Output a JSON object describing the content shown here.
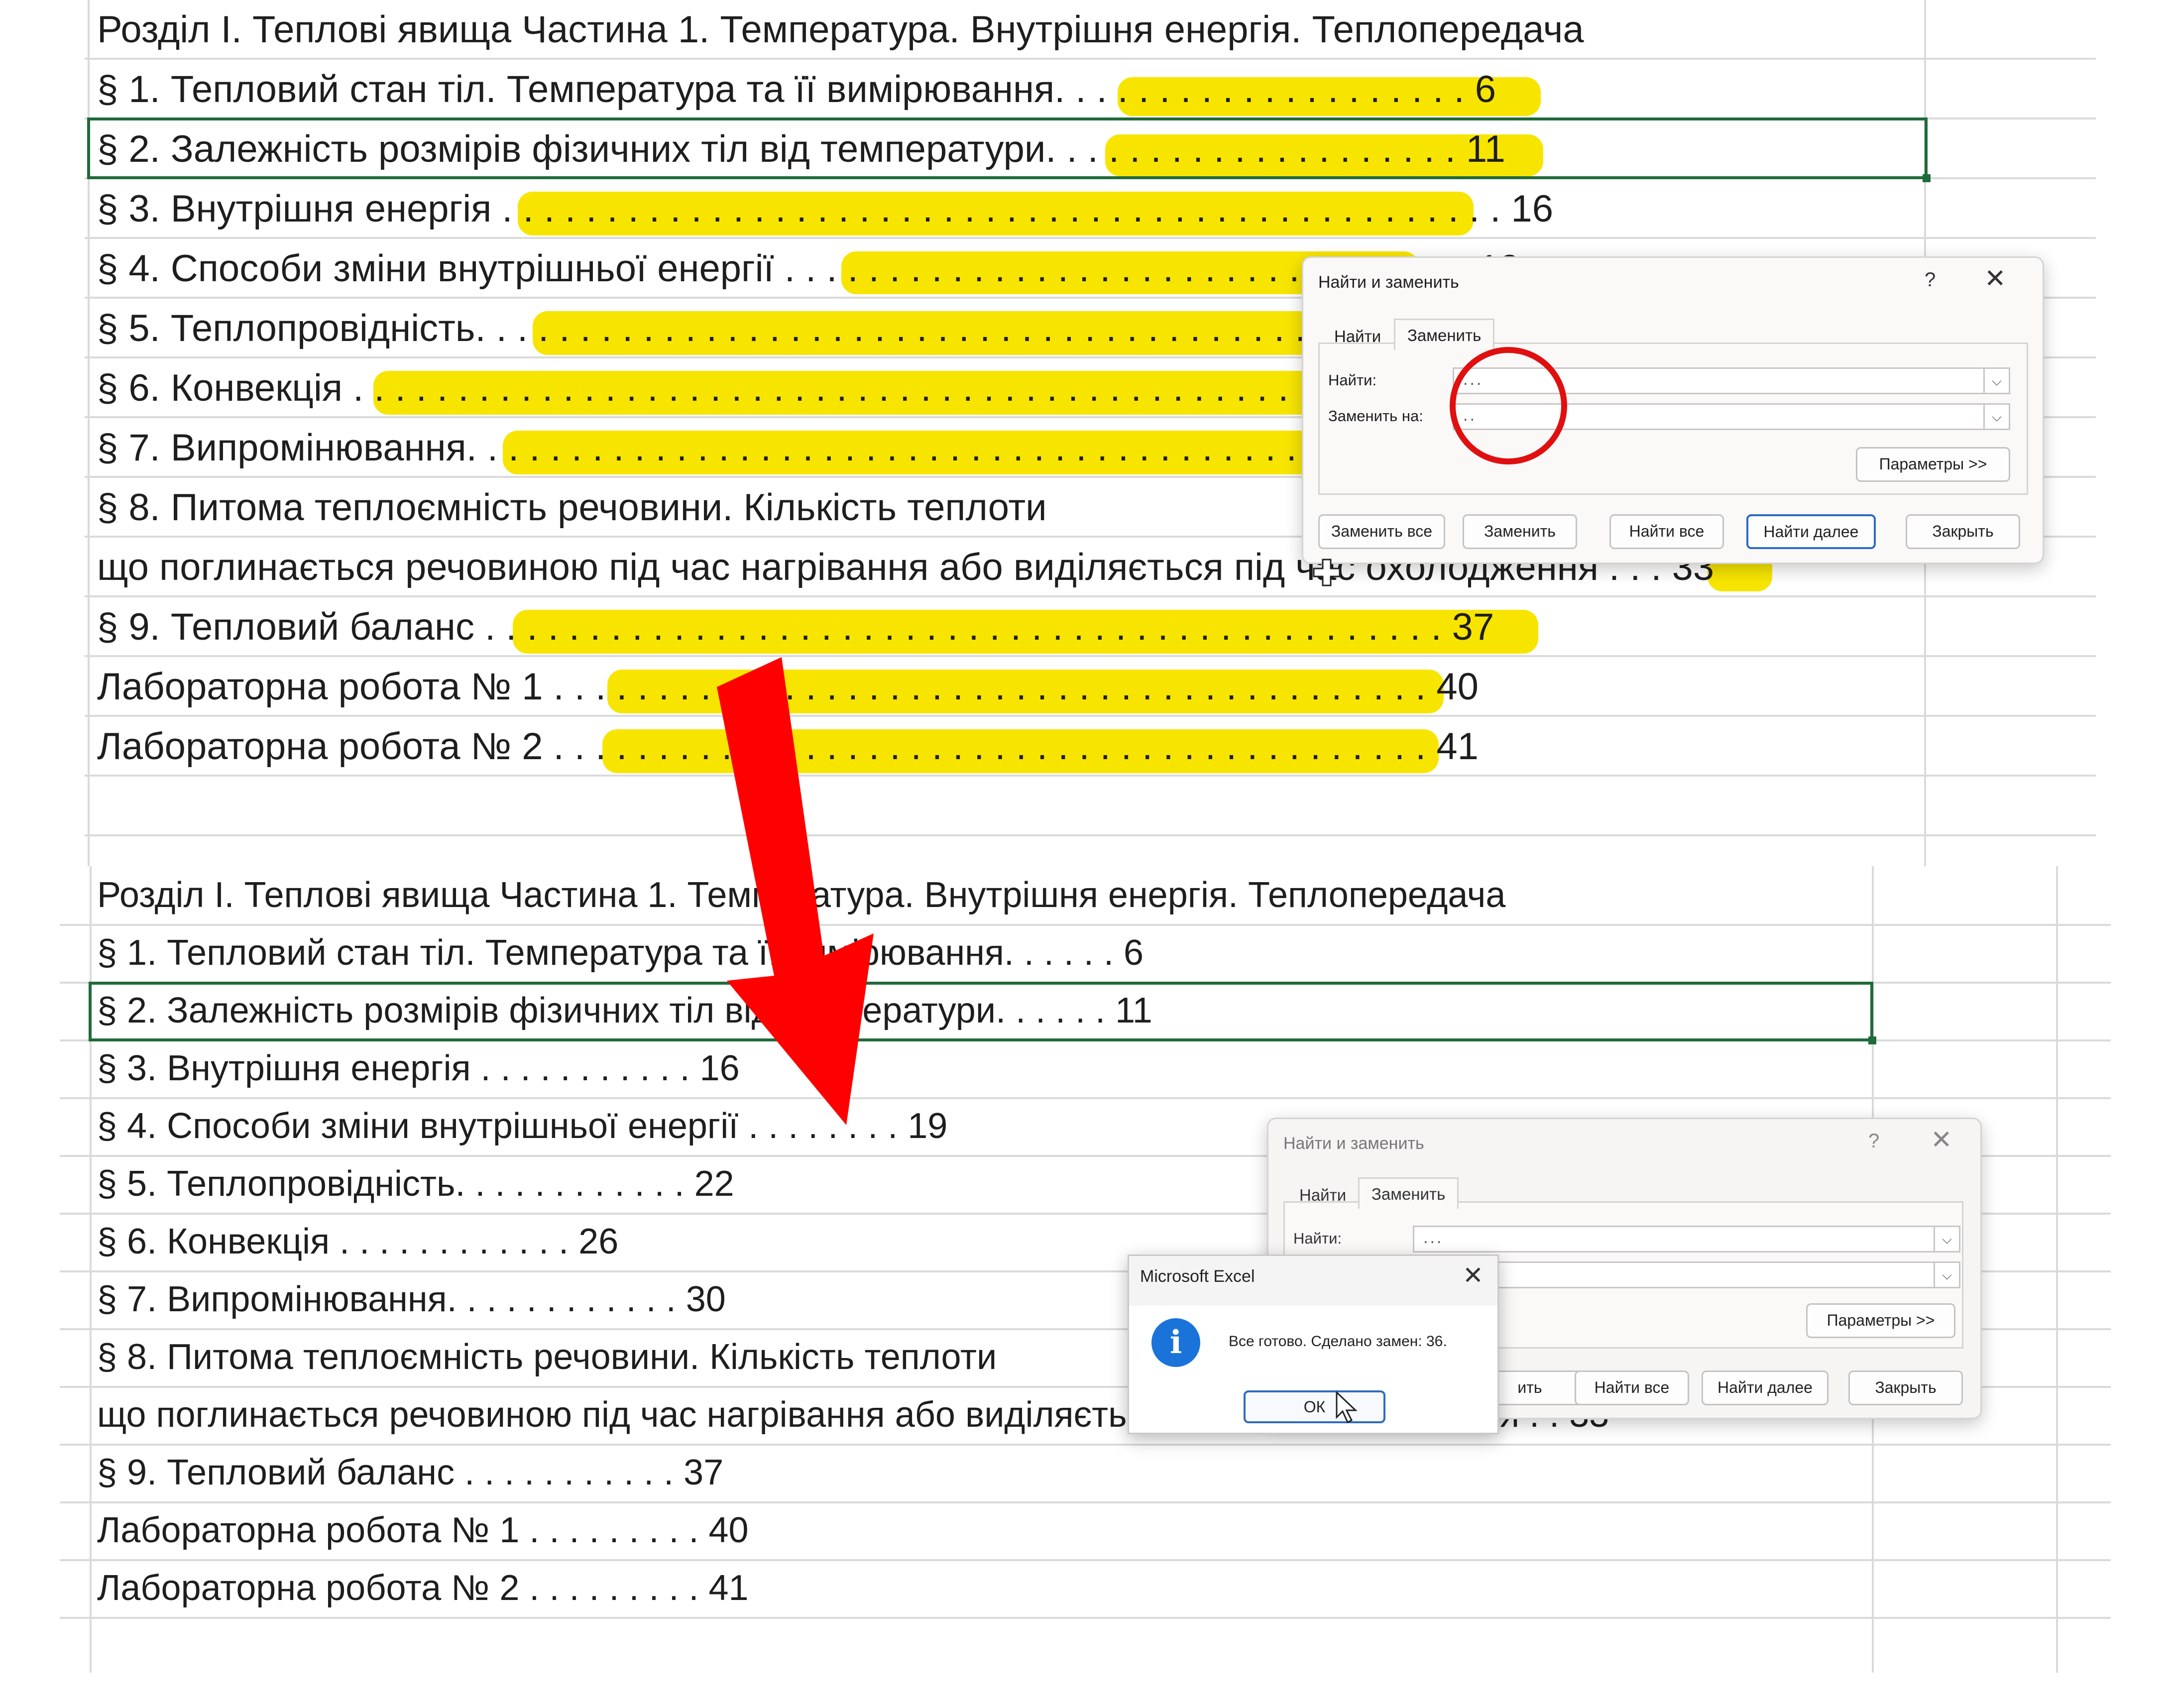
{
  "top_sheet": {
    "rows": [
      "Розділ І. Теплові явища Частина 1. Температура. Внутрішня енергія. Теплопередача",
      "§ 1. Тепловий стан тіл. Температура та її вимірювання. . . . . . . . . . . . . . . . . . . . 6",
      "§ 2. Залежність розмірів фізичних тіл від температури. . . . . . . . . . . . . . . . . . . . 11",
      "§ 3. Внутрішня енергія . . . . . . . . . . . . . . . . . . . . . . . . . . . . . . . . . . . . . . . . . . . . . . . . 16",
      "§ 4. Способи зміни внутрішньої енергії . . . . . . . . . . . . . . . . . . . . . . . . . . . . . . . . . 19",
      "§ 5. Теплопровідність. . . . . . . . . . . . . . . . . . . . . . . . . . . . . . . . . . . . . . . . . . . . . . . 22",
      "§ 6. Конвекція . . . . . . . . . . . . . . . . . . . . . . . . . . . . . . . . . . . . . . . . . . . . . . . . . . . . . . 26",
      "§ 7. Випромінювання. . . . . . . . . . . . . . . . . . . . . . . . . . . . . . . . . . . . . . . . . . . . . . . 30",
      "§ 8. Питома теплоємність речовини. Кількість теплоти",
      " що поглинається речовиною під час нагрівання або виділяється під час охолодження . . . 33",
      "§ 9. Тепловий баланс . . . . . . . . . . . . . . . . . . . . . . . . . . . . . . . . . . . . . . . . . . . . . . 37",
      "Лабораторна робота № 1 . . . . . . . . . . . . . . . . . . . . . . . . . . . . . . . . . . . . . . . . . . 40",
      "Лабораторна робота № 2 . . . . . . . . . . . . . . . . . . . . . . . . . . . . . . . . . . . . . . . . . . 41"
    ]
  },
  "bottom_sheet": {
    "rows": [
      "Розділ І. Теплові явища Частина 1. Температура. Внутрішня енергія. Теплопередача",
      "§ 1. Тепловий стан тіл. Температура та її вимірювання. . . . . . 6",
      "§ 2. Залежність розмірів фізичних тіл від температури. . . . . . 11",
      "§ 3. Внутрішня енергія . . . . . . . . . . . 16",
      "§ 4. Способи зміни внутрішньої енергії . . . . . . . . 19",
      "§ 5. Теплопровідність. . . . . . . . . . . . 22",
      "§ 6. Конвекція . . . . . . . . . . . . 26",
      "§ 7. Випромінювання. . . . . . . . . . . . 30",
      "§ 8. Питома теплоємність речовини. Кількість теплоти",
      " що поглинається речовиною під час нагрівання або виділяється під час охолодження . . 33",
      "§ 9. Тепловий баланс . . . . . . . . . . . 37",
      "Лабораторна робота № 1 . . . . . . . . . 40",
      "Лабораторна робота № 2 . . . . . . . . . 41"
    ]
  },
  "find_replace_dialog_top": {
    "title": "Найти и заменить",
    "help": "?",
    "close": "✕",
    "tabs": [
      "Найти",
      "Заменить"
    ],
    "find_label": "Найти:",
    "find_value": "...",
    "replace_label": "Заменить на:",
    "replace_value": "..",
    "options_button": "Параметры >>",
    "buttons": [
      "Заменить все",
      "Заменить",
      "Найти все",
      "Найти далее",
      "Закрыть"
    ]
  },
  "find_replace_dialog_bottom": {
    "title": "Найти и заменить",
    "help": "?",
    "close": "✕",
    "tabs": [
      "Найти",
      "Заменить"
    ],
    "find_label": "Найти:",
    "find_value": "...",
    "options_button": "Параметры >>",
    "buttons": [
      "ить",
      "Найти все",
      "Найти далее",
      "Закрыть"
    ]
  },
  "message_box": {
    "title": "Microsoft Excel",
    "close": "✕",
    "icon": "info-icon",
    "message": "Все готово. Сделано замен: 36.",
    "ok": "ОК"
  },
  "colors": {
    "highlight": "#f7e500",
    "selection": "#1f6b3a",
    "arrow": "#ff0000",
    "annotation_circle": "#e01010",
    "info_icon": "#1a73d9"
  }
}
